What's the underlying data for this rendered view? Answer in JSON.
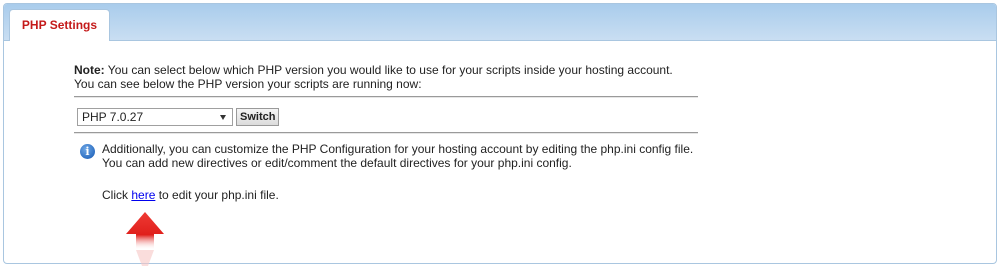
{
  "tab": {
    "label": "PHP Settings"
  },
  "note": {
    "bold": "Note:",
    "line1": " You can select below which PHP version you would like to use for your scripts inside your hosting account.",
    "line2": "You can see below the PHP version your scripts are running now:"
  },
  "php_select": {
    "selected": "PHP 7.0.27"
  },
  "switch_button": {
    "label": "Switch"
  },
  "info": {
    "icon_glyph": "i",
    "line1": "Additionally, you can customize the PHP Configuration for your hosting account by editing the php.ini config file.",
    "line2": "You can add new directives or edit/comment the default directives for your php.ini config."
  },
  "click_line": {
    "before": "Click ",
    "link": "here",
    "after": " to edit your php.ini file."
  },
  "colors": {
    "tab_text": "#c41a1a",
    "header_bar": "#b7d3ef",
    "link": "#0000ee",
    "pointer_arrow": "#e0201c"
  },
  "icons": {
    "info": "info-icon",
    "dropdown": "chevron-down-icon",
    "pointer": "red-arrow-up-icon"
  }
}
